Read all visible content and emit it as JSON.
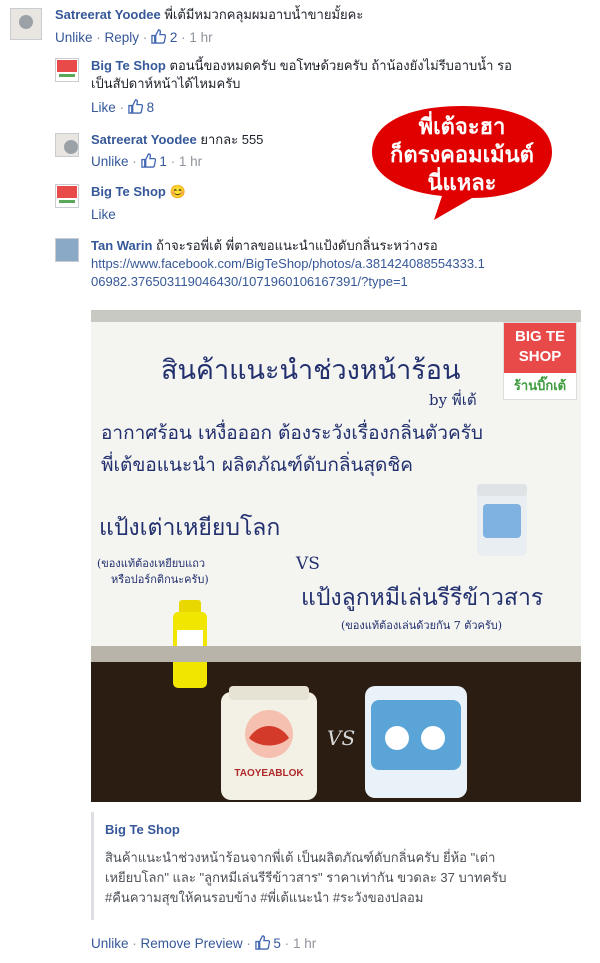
{
  "comments": [
    {
      "author": "Satreerat Yoodee",
      "text": "พี่เต้มีหมวกคลุมผมอาบน้ำขายมั้ยคะ",
      "actions": {
        "unlike": "Unlike",
        "reply": "Reply",
        "likes": "2",
        "time": "1 hr"
      }
    },
    {
      "author": "Big Te Shop",
      "text_line1": "ตอนนี้ของหมดครับ ขอโทษด้วยครับ ถ้าน้องยังไม่รีบอาบน้ำ รอ",
      "text_line2": "เป็นสัปดาห์หน้าได้ไหมครับ",
      "actions": {
        "like": "Like",
        "likes": "8"
      }
    },
    {
      "author": "Satreerat Yoodee",
      "text": "ยากละ 555",
      "actions": {
        "unlike": "Unlike",
        "likes": "1",
        "time": "1 hr"
      }
    },
    {
      "author": "Big Te Shop",
      "text": "😊",
      "actions": {
        "like": "Like"
      }
    },
    {
      "author": "Tan Warin",
      "text": "ถ้าจะรอพี่เต้ พี่ตาลขอแนะนำแป้งดับกลิ่นระหว่างรอ",
      "link_line1": "https://www.facebook.com/BigTeShop/photos/a.381424088554333.1",
      "link_line2": "06982.376503119046430/1071960106167391/?type=1",
      "actions": {
        "unlike": "Unlike",
        "remove_preview": "Remove Preview",
        "likes": "5",
        "time": "1 hr"
      }
    }
  ],
  "bubble": {
    "line1": "พี่เต้จะฮา",
    "line2": "ก็ตรงคอมเม้นต์",
    "line3": "นี่แหละ",
    "color": "#e00000"
  },
  "photo": {
    "board_line1": "สินค้าแนะนำช่วงหน้าร้อน",
    "board_by": "by พี่เต้",
    "board_line2": "อากาศร้อน เหงื่อออก ต้องระวังเรื่องกลิ่นตัวครับ",
    "board_line3": "พี่เต้ขอแนะนำ ผลิตภัณฑ์ดับกลิ่นสุดชิค",
    "board_line4": "แป้งเต่าเหยียบโลก",
    "board_note1": "(ของแท้ต้องเหยียบแถว",
    "board_note2": "หรือปอร์กติกนะครับ)",
    "board_vs": "VS",
    "board_line5": "แป้งลูกหมีเล่นรีรีข้าวสาร",
    "board_note3": "(ของแท้ต้องเล่นด้วยกัน 7 ตัวครับ)",
    "logo_line1": "BIG TE",
    "logo_line2": "SHOP",
    "logo_thai": "ร้านบิ๊กเต้",
    "bottle1_label": "TAOYEABLOK",
    "bottom_vs": "VS"
  },
  "preview": {
    "title": "Big Te Shop",
    "line1": "สินค้าแนะนำช่วงหน้าร้อนจากพี่เต้ เป็นผลิตภัณฑ์ดับกลิ่นครับ ยี่ห้อ \"เต่า",
    "line2": "เหยียบโลก\" และ \"ลูกหมีเล่นรีรีข้าวสาร\" ราคาเท่ากัน ขวดละ 37 บาทครับ",
    "line3": "#คืนความสุขให้คนรอบข้าง #พี่เต้แนะนำ #ระวังของปลอม"
  },
  "colors": {
    "link": "#365899",
    "meta": "#90949c",
    "text": "#1d2129"
  }
}
